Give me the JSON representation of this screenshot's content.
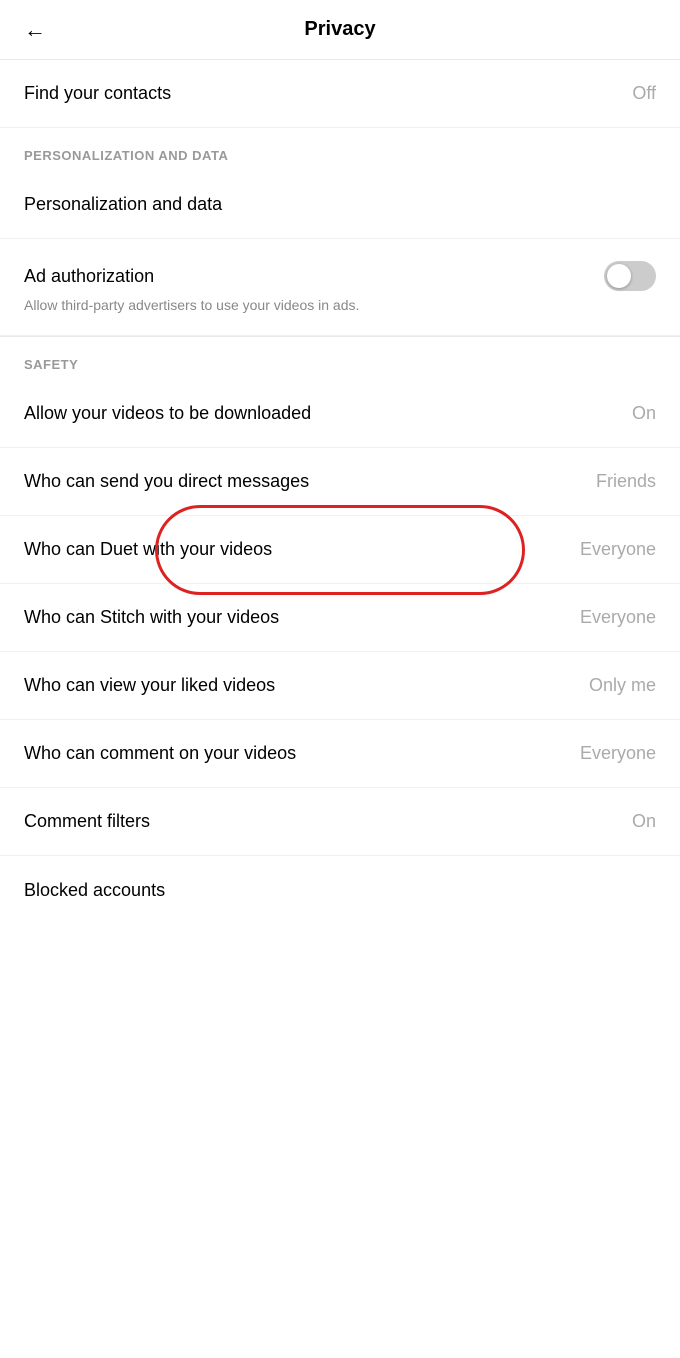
{
  "header": {
    "title": "Privacy",
    "back_label": "←"
  },
  "sections": {
    "contacts": {
      "label": "Find your contacts",
      "value": "Off"
    },
    "personalization_section": "PERSONALIZATION AND DATA",
    "personalization": {
      "label": "Personalization and data"
    },
    "ad_authorization": {
      "label": "Ad authorization",
      "description": "Allow third-party advertisers to use your videos in ads.",
      "toggle_state": "off"
    },
    "safety_section": "SAFETY",
    "safety_items": [
      {
        "id": "allow-downloads",
        "label": "Allow your videos to be downloaded",
        "value": "On"
      },
      {
        "id": "direct-messages",
        "label": "Who can send you direct messages",
        "value": "Friends"
      },
      {
        "id": "duet",
        "label": "Who can Duet with your videos",
        "value": "Everyone",
        "highlighted": true
      },
      {
        "id": "stitch",
        "label": "Who can Stitch with your videos",
        "value": "Everyone"
      },
      {
        "id": "liked-videos",
        "label": "Who can view your liked videos",
        "value": "Only me"
      },
      {
        "id": "comments",
        "label": "Who can comment on your videos",
        "value": "Everyone"
      },
      {
        "id": "comment-filters",
        "label": "Comment filters",
        "value": "On"
      },
      {
        "id": "blocked-accounts",
        "label": "Blocked accounts",
        "value": ""
      }
    ]
  }
}
